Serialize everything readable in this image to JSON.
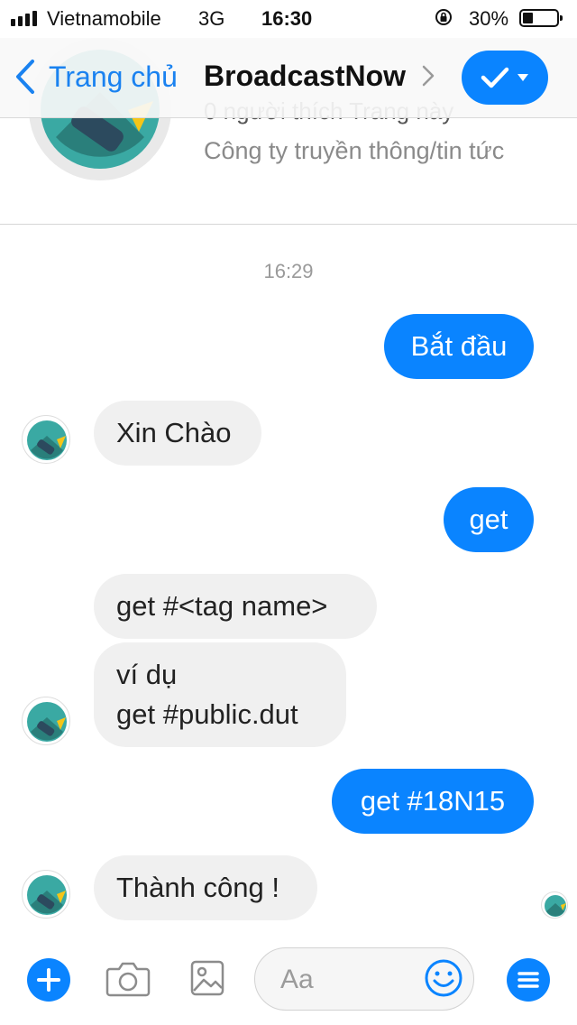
{
  "status_bar": {
    "carrier": "Vietnamobile",
    "network": "3G",
    "time": "16:30",
    "battery": "30%",
    "battery_level": 0.3
  },
  "nav": {
    "back_label": "Trang chủ",
    "title": "BroadcastNow"
  },
  "profile": {
    "likes": "0 người thích Trang này",
    "category": "Công ty truyền thông/tin tức"
  },
  "chat": {
    "timestamp": "16:29",
    "messages": [
      {
        "dir": "out",
        "text": "Bắt đầu"
      },
      {
        "dir": "in",
        "text": "Xin Chào"
      },
      {
        "dir": "out",
        "text": "get"
      },
      {
        "dir": "in",
        "text": "get #<tag name>"
      },
      {
        "dir": "in",
        "lines": [
          "ví dụ",
          "get #public.dut"
        ]
      },
      {
        "dir": "out",
        "text": "get #18N15"
      },
      {
        "dir": "in",
        "text": "Thành công !"
      }
    ]
  },
  "composer": {
    "placeholder": "Aa"
  },
  "colors": {
    "accent": "#0a84ff",
    "incoming_bubble": "#f0f0f0",
    "logo_teal": "#2f8f8a",
    "logo_yellow": "#f5c518"
  },
  "icons": [
    "signal-icon",
    "rotation-lock-icon",
    "battery-icon",
    "back-chevron-icon",
    "chevron-right-icon",
    "checkmark-icon",
    "caret-down-icon",
    "plus-icon",
    "camera-icon",
    "gallery-icon",
    "emoji-icon",
    "menu-icon"
  ]
}
